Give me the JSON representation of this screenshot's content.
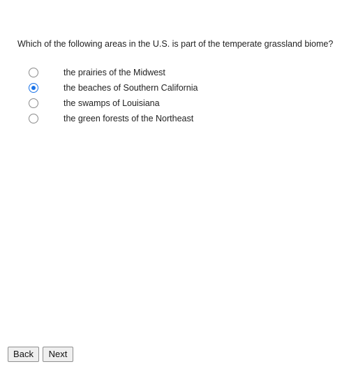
{
  "question": "Which of the following areas in the U.S. is part of the temperate grassland biome?",
  "options": [
    {
      "label": "the prairies of the Midwest",
      "selected": false
    },
    {
      "label": "the beaches of Southern California",
      "selected": true
    },
    {
      "label": "the swamps of Louisiana",
      "selected": false
    },
    {
      "label": "the green forests of the Northeast",
      "selected": false
    }
  ],
  "buttons": {
    "back": "Back",
    "next": "Next"
  },
  "colors": {
    "accent": "#1a73e8"
  }
}
